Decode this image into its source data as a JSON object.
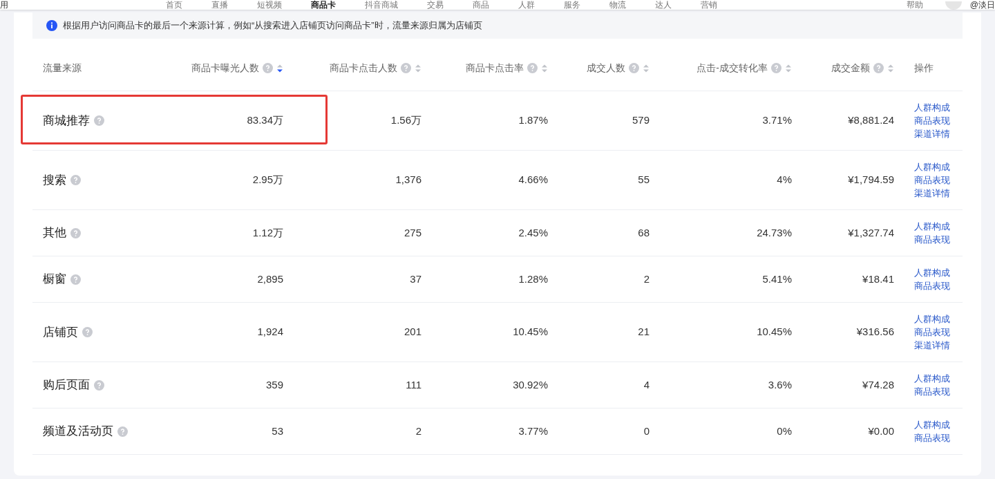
{
  "top_nav": {
    "left_label": "用",
    "items": [
      {
        "label": "首页",
        "selected": false
      },
      {
        "label": "直播",
        "selected": false
      },
      {
        "label": "短视频",
        "selected": false
      },
      {
        "label": "商品卡",
        "selected": true
      },
      {
        "label": "抖音商城",
        "selected": false
      },
      {
        "label": "交易",
        "selected": false
      },
      {
        "label": "商品",
        "selected": false
      },
      {
        "label": "人群",
        "selected": false
      },
      {
        "label": "服务",
        "selected": false
      },
      {
        "label": "物流",
        "selected": false
      },
      {
        "label": "达人",
        "selected": false
      },
      {
        "label": "营销",
        "selected": false
      }
    ],
    "help": "帮助",
    "account": "@淡日"
  },
  "notice": "根据用户访问商品卡的最后一个来源计算，例如“从搜索进入店铺页访问商品卡”时，流量来源归属为店铺页",
  "table": {
    "columns": [
      {
        "label": "流量来源",
        "help": false,
        "sortable": false
      },
      {
        "label": "商品卡曝光人数",
        "help": true,
        "sortable": true,
        "sorted": true
      },
      {
        "label": "商品卡点击人数",
        "help": true,
        "sortable": true,
        "sorted": false
      },
      {
        "label": "商品卡点击率",
        "help": true,
        "sortable": true,
        "sorted": false
      },
      {
        "label": "成交人数",
        "help": true,
        "sortable": true,
        "sorted": false
      },
      {
        "label": "点击-成交转化率",
        "help": true,
        "sortable": true,
        "sorted": false
      },
      {
        "label": "成交金额",
        "help": true,
        "sortable": true,
        "sorted": false
      },
      {
        "label": "操作",
        "help": false,
        "sortable": false
      }
    ],
    "rows": [
      {
        "source": "商城推荐",
        "highlighted": true,
        "cells": [
          "83.34万",
          "1.56万",
          "1.87%",
          "579",
          "3.71%",
          "¥8,881.24"
        ],
        "actions": [
          "人群构成",
          "商品表现",
          "渠道详情"
        ]
      },
      {
        "source": "搜索",
        "highlighted": false,
        "cells": [
          "2.95万",
          "1,376",
          "4.66%",
          "55",
          "4%",
          "¥1,794.59"
        ],
        "actions": [
          "人群构成",
          "商品表现",
          "渠道详情"
        ]
      },
      {
        "source": "其他",
        "highlighted": false,
        "cells": [
          "1.12万",
          "275",
          "2.45%",
          "68",
          "24.73%",
          "¥1,327.74"
        ],
        "actions": [
          "人群构成",
          "商品表现"
        ]
      },
      {
        "source": "橱窗",
        "highlighted": false,
        "cells": [
          "2,895",
          "37",
          "1.28%",
          "2",
          "5.41%",
          "¥18.41"
        ],
        "actions": [
          "人群构成",
          "商品表现"
        ]
      },
      {
        "source": "店铺页",
        "highlighted": false,
        "cells": [
          "1,924",
          "201",
          "10.45%",
          "21",
          "10.45%",
          "¥316.56"
        ],
        "actions": [
          "人群构成",
          "商品表现",
          "渠道详情"
        ]
      },
      {
        "source": "购后页面",
        "highlighted": false,
        "cells": [
          "359",
          "111",
          "30.92%",
          "4",
          "3.6%",
          "¥74.28"
        ],
        "actions": [
          "人群构成",
          "商品表现"
        ]
      },
      {
        "source": "频道及活动页",
        "highlighted": false,
        "cells": [
          "53",
          "2",
          "3.77%",
          "0",
          "0%",
          "¥0.00"
        ],
        "actions": [
          "人群构成",
          "商品表现"
        ]
      }
    ]
  }
}
